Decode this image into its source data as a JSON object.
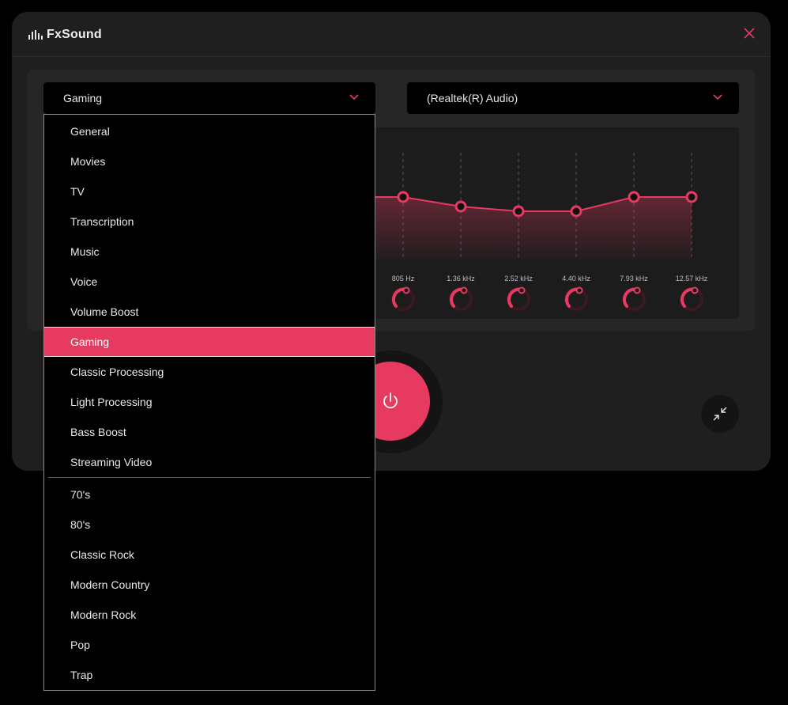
{
  "app": {
    "title": "FxSound"
  },
  "preset_select": {
    "value": "Gaming"
  },
  "device_select": {
    "value": "(Realtek(R) Audio)"
  },
  "presets_menu": {
    "items": [
      "General",
      "Movies",
      "TV",
      "Transcription",
      "Music",
      "Voice",
      "Volume Boost",
      "Gaming",
      "Classic Processing",
      "Light Processing",
      "Bass Boost",
      "Streaming Video"
    ],
    "extra_items": [
      "70's",
      "80's",
      "Classic Rock",
      "Modern Country",
      "Modern Rock",
      "Pop",
      "Trap"
    ],
    "selected": "Gaming"
  },
  "eq": {
    "bands": [
      "805 Hz",
      "1.36 kHz",
      "2.52 kHz",
      "4.40 kHz",
      "7.93 kHz",
      "12.57 kHz"
    ]
  },
  "colors": {
    "accent": "#e63a61",
    "window_bg": "#1f1f1f",
    "panel_bg": "#262626"
  },
  "icons": {
    "close": "close-icon",
    "chevron": "chevron-down-icon",
    "power": "power-icon",
    "shrink": "shrink-icon"
  }
}
